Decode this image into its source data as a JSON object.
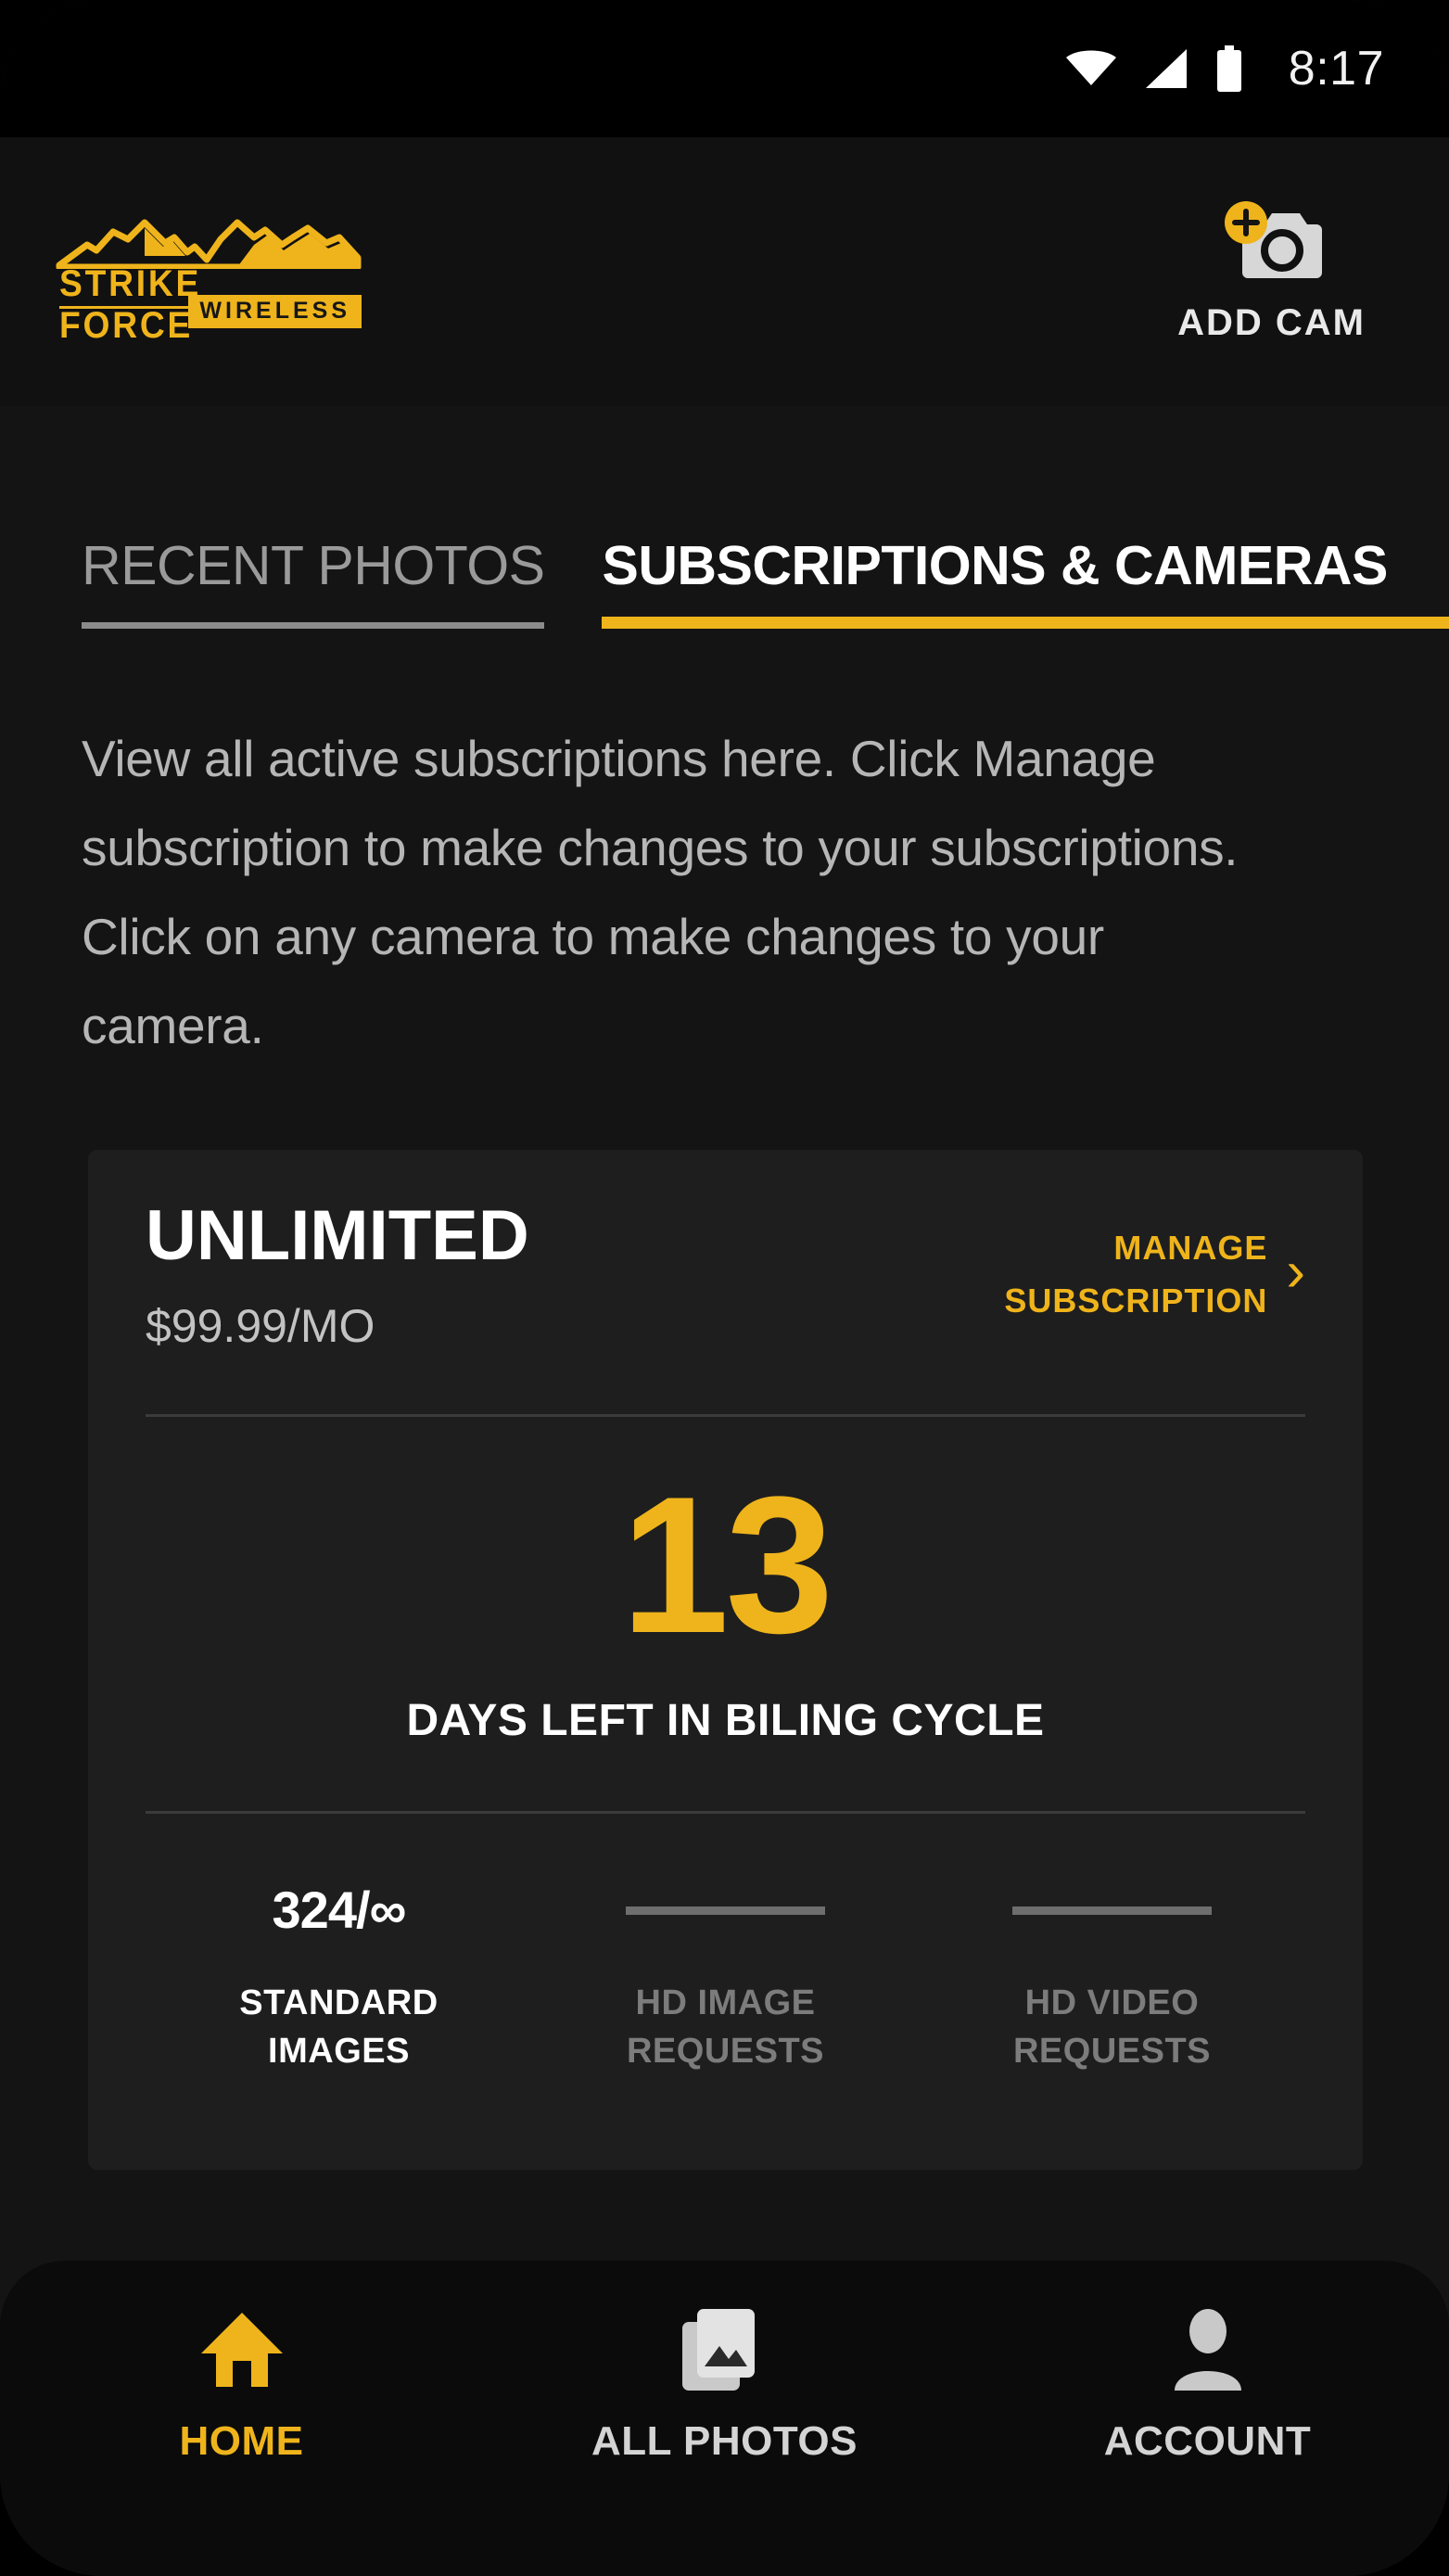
{
  "status_bar": {
    "time": "8:17",
    "icons": [
      "wifi-icon",
      "cellular-signal-icon",
      "battery-icon"
    ]
  },
  "header": {
    "logo": {
      "word": "STRIKE FORCE",
      "badge": "WIRELESS",
      "icon": "mountain-range-icon",
      "color": "#EFB41B"
    },
    "add_cam": {
      "label": "ADD CAM",
      "icon": "camera-plus-icon"
    }
  },
  "tabs": [
    {
      "label": "RECENT PHOTOS",
      "active": false
    },
    {
      "label": "SUBSCRIPTIONS & CAMERAS",
      "active": true
    }
  ],
  "description": "View all active subscriptions here. Click Manage subscription to make changes to your subscriptions. Click on any camera to make changes to your camera.",
  "subscription_card": {
    "plan_name": "UNLIMITED",
    "plan_price": "$99.99/MO",
    "manage_line1": "MANAGE",
    "manage_line2": "SUBSCRIPTION",
    "manage_chevron": "chevron-right-icon",
    "days_number": "13",
    "days_label": "DAYS LEFT IN BILING CYCLE",
    "stats": [
      {
        "value": "324/∞",
        "label": "STANDARD IMAGES",
        "state": "active"
      },
      {
        "value": "",
        "label": "HD IMAGE REQUESTS",
        "state": "muted"
      },
      {
        "value": "",
        "label": "HD VIDEO REQUESTS",
        "state": "muted"
      }
    ]
  },
  "bottom_nav": [
    {
      "label": "HOME",
      "icon": "home-icon",
      "active": true
    },
    {
      "label": "ALL PHOTOS",
      "icon": "photos-stack-icon",
      "active": false
    },
    {
      "label": "ACCOUNT",
      "icon": "person-icon",
      "active": false
    }
  ],
  "theme": {
    "accent": "#EFB41B",
    "page_bg": "#141414",
    "card_bg": "#1E1E1E",
    "nav_bg": "#0B0B0B"
  }
}
